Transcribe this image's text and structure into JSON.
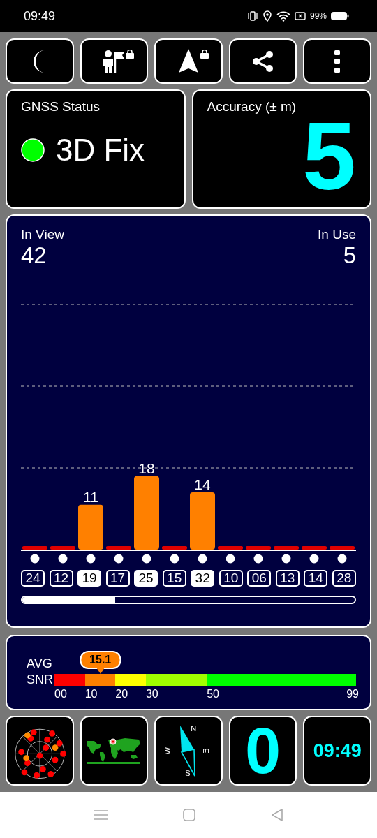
{
  "status_bar": {
    "time": "09:49",
    "battery": "99%"
  },
  "toolbar": [
    {
      "kind": "moon",
      "locked": false
    },
    {
      "kind": "person",
      "locked": true
    },
    {
      "kind": "arrow",
      "locked": true
    },
    {
      "kind": "share",
      "locked": false
    },
    {
      "kind": "more",
      "locked": false
    }
  ],
  "gnss_status": {
    "title": "GNSS Status",
    "fix": "3D Fix"
  },
  "accuracy": {
    "title": "Accuracy (± m)",
    "value": "5"
  },
  "satellites_panel": {
    "in_view_label": "In View",
    "in_view": "42",
    "in_use_label": "In Use",
    "in_use": "5",
    "chart_data": {
      "type": "bar",
      "categories": [
        "24",
        "12",
        "19",
        "17",
        "25",
        "15",
        "32",
        "10",
        "06",
        "13",
        "14",
        "28"
      ],
      "series": [
        {
          "color": "#ff8000",
          "values": [
            null,
            null,
            11,
            null,
            18,
            null,
            14,
            null,
            null,
            null,
            null,
            null
          ]
        }
      ],
      "data_labels": true
    },
    "satellites": [
      {
        "in_use": false
      },
      {
        "in_use": false
      },
      {
        "in_use": true
      },
      {
        "in_use": false
      },
      {
        "in_use": true
      },
      {
        "in_use": false
      },
      {
        "in_use": true
      },
      {
        "in_use": false
      },
      {
        "in_use": false
      },
      {
        "in_use": false
      },
      {
        "in_use": false
      },
      {
        "in_use": false
      }
    ]
  },
  "snr": {
    "label_top": "AVG",
    "label_bottom": "SNR",
    "average": "15.1",
    "segments": [
      {
        "label": "00",
        "color": "#ff0000"
      },
      {
        "label": "10",
        "color": "#ff8000"
      },
      {
        "label": "20",
        "color": "#ffff00"
      },
      {
        "label": "30",
        "color": "#a0ff00"
      },
      {
        "label": "50",
        "color": "#00ff00"
      }
    ],
    "end_label": "99"
  },
  "tiles": {
    "compass": {
      "north": "N",
      "east": "E",
      "south": "S",
      "west": "W"
    },
    "count": "0",
    "clock": "09:49"
  }
}
